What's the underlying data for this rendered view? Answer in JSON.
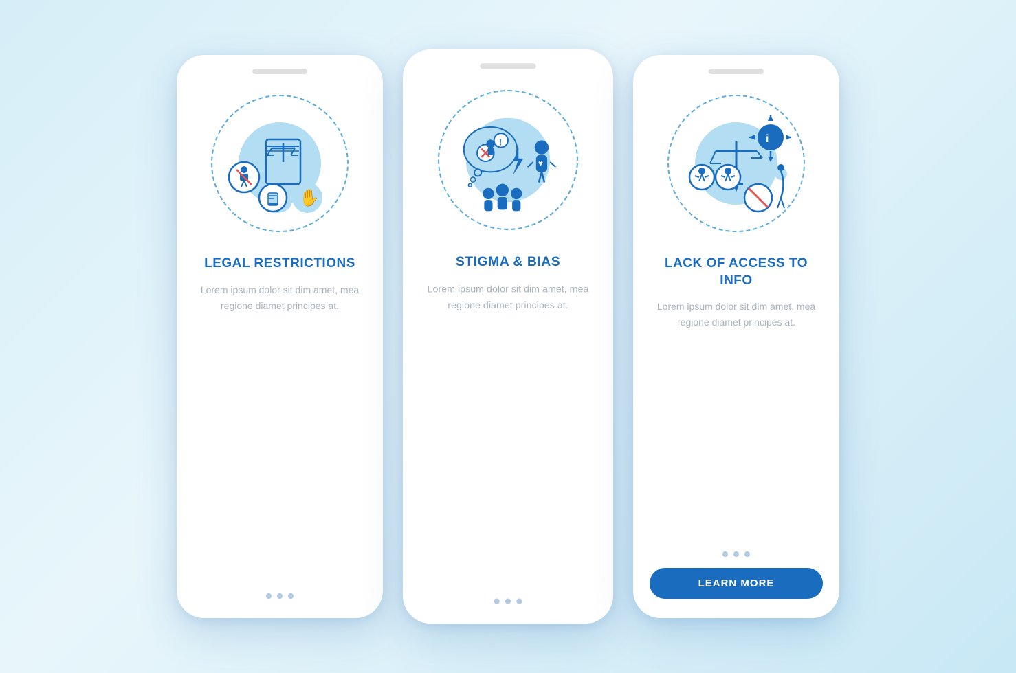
{
  "background": {
    "color_start": "#d6eef8",
    "color_end": "#c8e8f5"
  },
  "phones": [
    {
      "id": "phone-legal",
      "title": "LEGAL\nRESTRICTIONS",
      "description": "Lorem ipsum dolor sit dim amet, mea regione diamet principes at.",
      "dots": [
        false,
        false,
        false
      ],
      "show_button": false,
      "button_label": ""
    },
    {
      "id": "phone-stigma",
      "title": "STIGMA & BIAS",
      "description": "Lorem ipsum dolor sit dim amet, mea regione diamet principes at.",
      "dots": [
        false,
        false,
        false
      ],
      "show_button": false,
      "button_label": ""
    },
    {
      "id": "phone-access",
      "title": "LACK OF ACCESS\nTO INFO",
      "description": "Lorem ipsum dolor sit dim amet, mea regione diamet principes at.",
      "dots": [
        false,
        false,
        false
      ],
      "show_button": true,
      "button_label": "LEARN MORE"
    }
  ],
  "accent_color": "#1a6dbe",
  "light_blue": "#b3ddf2",
  "dashed_color": "#5aacda",
  "text_color": "#aab4be"
}
